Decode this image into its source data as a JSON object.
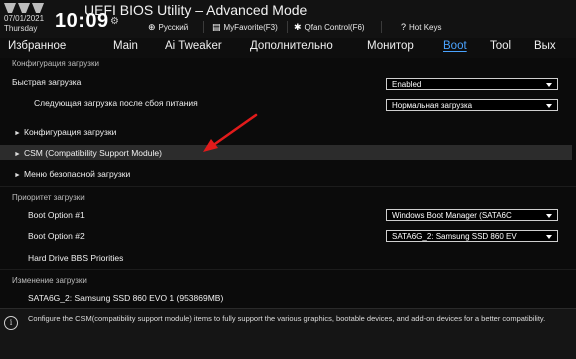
{
  "header": {
    "date": "07/01/2021",
    "day": "Thursday",
    "time": "10:09",
    "title": "UEFI BIOS Utility – Advanced Mode",
    "items": [
      {
        "icon": "globe-icon",
        "label": "Русский"
      },
      {
        "icon": "favorite-icon",
        "label": "MyFavorite(F3)"
      },
      {
        "icon": "fan-icon",
        "label": "Qfan Control(F6)"
      },
      {
        "icon": "help-icon",
        "label": "Hot Keys"
      }
    ]
  },
  "tabs": [
    {
      "label": "Избранное"
    },
    {
      "label": "Main"
    },
    {
      "label": "Ai Tweaker"
    },
    {
      "label": "Дополнительно"
    },
    {
      "label": "Монитор"
    },
    {
      "label": "Boot"
    },
    {
      "label": "Tool"
    },
    {
      "label": "Вых"
    }
  ],
  "active_tab": "Boot",
  "content": {
    "boot_config_header": "Конфигурация загрузки",
    "fast_boot_label": "Быстрая загрузка",
    "fast_boot_value": "Enabled",
    "next_boot_label": "Следующая загрузка после сбоя питания",
    "next_boot_value": "Нормальная загрузка",
    "sub_boot_config": "Конфигурация загрузки",
    "csm": "CSM (Compatibility Support Module)",
    "secure_boot": "Меню безопасной загрузки",
    "priority_header": "Приоритет загрузки",
    "boot_option1_label": "Boot Option #1",
    "boot_option1_value": "Windows Boot Manager (SATA6C",
    "boot_option2_label": "Boot Option #2",
    "boot_option2_value": "SATA6G_2: Samsung SSD 860 EV",
    "hdd_priorities": "Hard Drive BBS Priorities",
    "change_boot_header": "Изменение загрузки",
    "change_boot_item": "SATA6G_2: Samsung SSD 860 EVO 1  (953869MB)"
  },
  "help": {
    "text": "Configure the CSM(compatibility support module) items to fully support the various graphics, bootable devices, and add-on devices for a better compatibility."
  },
  "colors": {
    "active_tab": "#4aa3ff",
    "highlight": "#2c2c2c",
    "arrow": "#e11b1b"
  }
}
